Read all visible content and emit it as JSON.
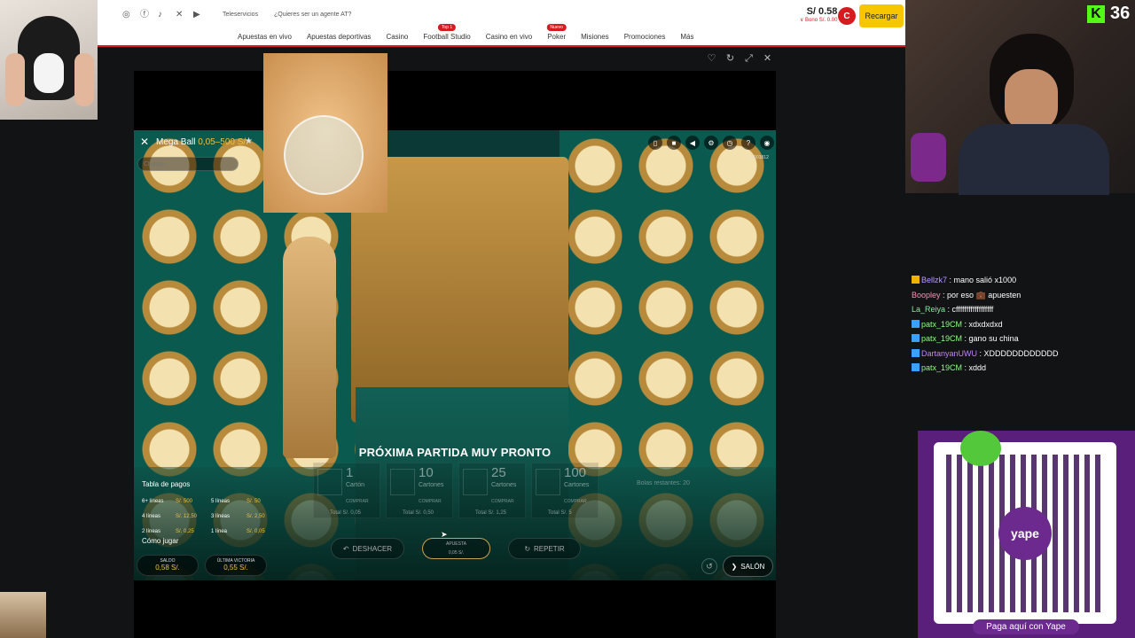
{
  "kick": {
    "logo": "K",
    "viewer_count": "36"
  },
  "site": {
    "tele": "Teleservicios",
    "agent": "¿Quieres ser un agente AT?",
    "nav": [
      {
        "label": "Apuestas en vivo",
        "badge": ""
      },
      {
        "label": "Apuestas deportivas",
        "badge": ""
      },
      {
        "label": "Casino",
        "badge": ""
      },
      {
        "label": "Football Studio",
        "badge": "Top 1"
      },
      {
        "label": "Casino en vivo",
        "badge": ""
      },
      {
        "label": "Poker",
        "badge": "Nuevo"
      },
      {
        "label": "Misiones",
        "badge": ""
      },
      {
        "label": "Promociones",
        "badge": ""
      },
      {
        "label": "Más",
        "badge": ""
      }
    ],
    "balance": "S/ 0.58",
    "bono": "∨ Bono S/. 0.00",
    "avatar": "C",
    "recargar": "Recargar"
  },
  "game": {
    "title": "Mega Ball",
    "range": "0,05–500 S/.",
    "chat_placeholder": "Chatear",
    "game_id": "# 003812",
    "next_round": "PRÓXIMA PARTIDA MUY PRONTO",
    "cards": [
      {
        "num": "1",
        "label": "Cartón",
        "buy": "COMPRAR",
        "total": "Total S/. 0,05"
      },
      {
        "num": "10",
        "label": "Cartones",
        "buy": "COMPRAR",
        "total": "Total S/. 0,50"
      },
      {
        "num": "25",
        "label": "Cartones",
        "buy": "COMPRAR",
        "total": "Total S/. 1,25"
      },
      {
        "num": "100",
        "label": "Cartones",
        "buy": "COMPRAR",
        "total": "Total S/. 5"
      }
    ],
    "bolas": "Bolas restantes: 20",
    "pay_title": "Tabla de pagos",
    "pay_rows": [
      {
        "l1": "6+ líneas",
        "v1": "S/. 500",
        "l2": "5 líneas",
        "v2": "S/. 50"
      },
      {
        "l1": "4 líneas",
        "v1": "S/. 12,50",
        "l2": "3 líneas",
        "v2": "S/. 2,50"
      },
      {
        "l1": "2 líneas",
        "v1": "S/. 0,25",
        "l2": "1 línea",
        "v2": "S/. 0,05"
      }
    ],
    "como": "Cómo jugar",
    "saldo_label": "SALDO",
    "saldo_value": "0,58 S/.",
    "ultima_label": "ÚLTIMA VICTORIA",
    "ultima_value": "0,55 S/.",
    "deshacer": "DESHACER",
    "apuesta_label": "APUESTA",
    "apuesta_value": "0,05 S/.",
    "repetir": "REPETIR",
    "salon": "SALÓN"
  },
  "chat": [
    {
      "user": "Bellzk7",
      "color": "#b99cff",
      "badge": "#f0b400",
      "text": "mano salió x1000"
    },
    {
      "user": "Boopley",
      "color": "#ff8fb8",
      "badge": "",
      "text": "por eso 💼 apuesten"
    },
    {
      "user": "La_Reiya",
      "color": "#7cf0a0",
      "badge": "",
      "text": "cffffffffffffffffff"
    },
    {
      "user": "patx_19CM",
      "color": "#8bff84",
      "badge": "#3aa0ff",
      "text": "xdxdxdxd"
    },
    {
      "user": "patx_19CM",
      "color": "#8bff84",
      "badge": "#3aa0ff",
      "text": "gano su china"
    },
    {
      "user": "DartanyanUWU",
      "color": "#c084ff",
      "badge": "#3aa0ff",
      "text": "XDDDDDDDDDDDD"
    },
    {
      "user": "patx_19CM",
      "color": "#8bff84",
      "badge": "#3aa0ff",
      "text": "xddd"
    }
  ],
  "yape": {
    "logo": "yape",
    "caption": "Paga aquí con Yape"
  }
}
